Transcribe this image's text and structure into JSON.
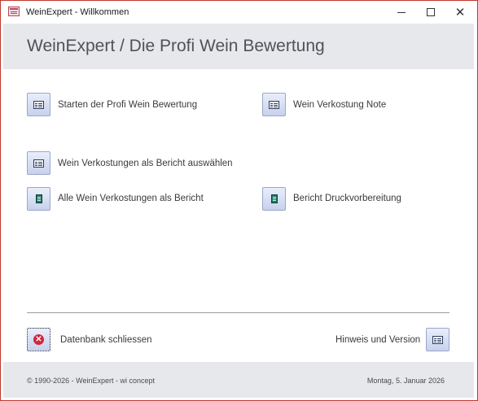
{
  "window": {
    "title": "WeinExpert - Willkommen",
    "close_glyph": "✕"
  },
  "header": {
    "title": "WeinExpert / Die Profi Wein Bewertung"
  },
  "buttons": {
    "starten": "Starten der Profi Wein Bewertung",
    "verkostung_note": "Wein Verkostung Note",
    "verkostungen_auswaehlen": "Wein Verkostungen als Bericht auswählen",
    "alle_verkostungen": "Alle Wein Verkostungen als Bericht",
    "druckvorbereitung": "Bericht Druckvorbereitung",
    "datenbank_schliessen": "Datenbank schliessen",
    "hinweis_version": "Hinweis und Version"
  },
  "icons": {
    "form": "form-icon",
    "report": "report-icon",
    "close_db": "close-circle-icon",
    "close_db_glyph": "✕"
  },
  "colors": {
    "header_bg": "#e6e8ec",
    "window_border": "#c0392b",
    "button_gradient_top": "#e9eefb",
    "button_gradient_bottom": "#c7d1ec",
    "close_icon": "#d3263a"
  },
  "footer": {
    "copyright": "© 1990-2026 - WeinExpert - wi concept",
    "date": "Montag, 5. Januar 2026"
  }
}
